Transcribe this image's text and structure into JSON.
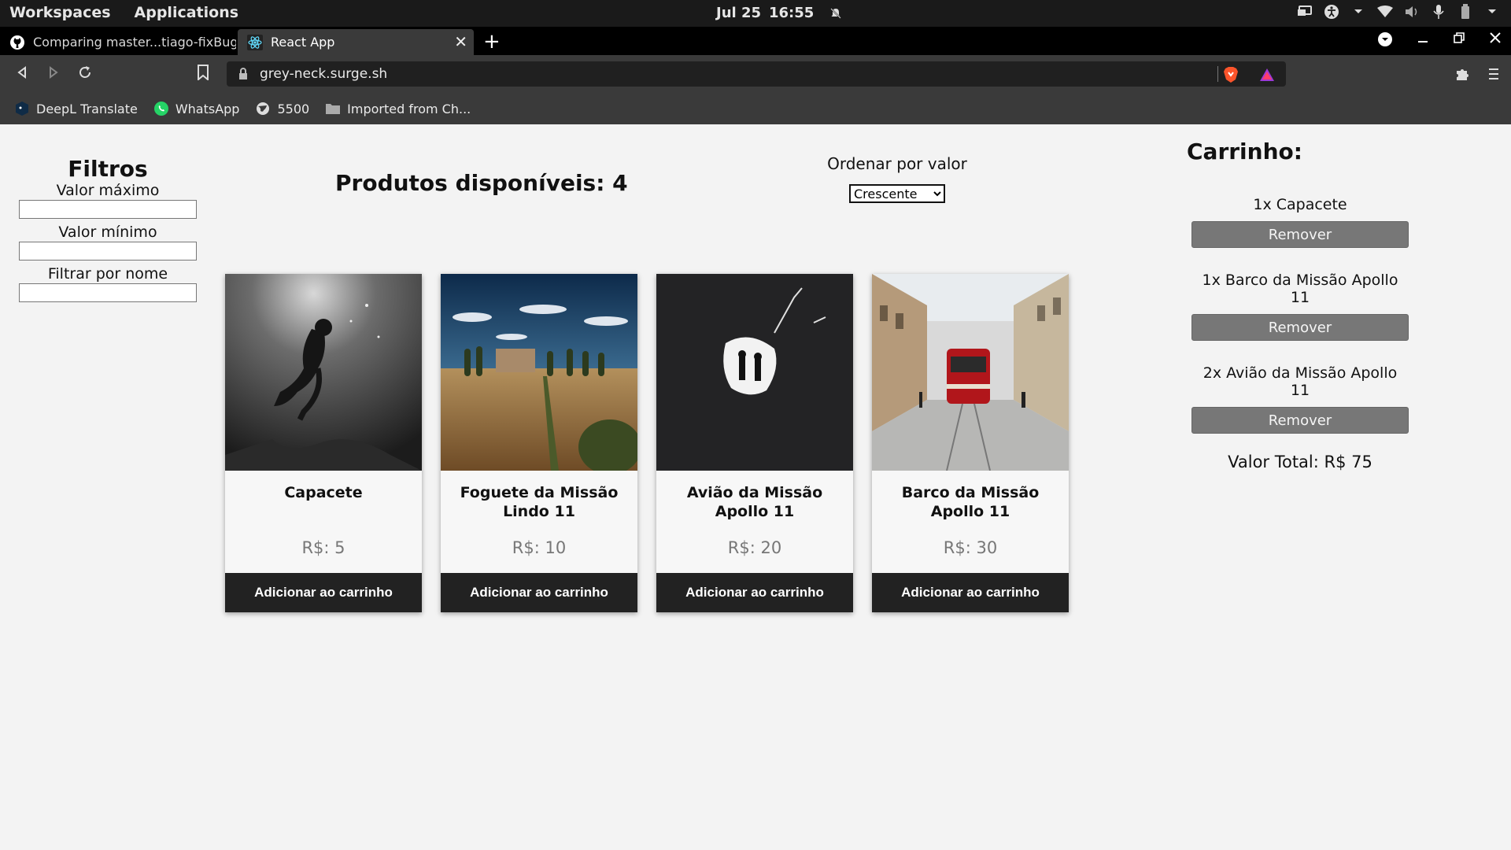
{
  "os": {
    "workspaces": "Workspaces",
    "applications": "Applications",
    "date": "Jul 25",
    "time": "16:55"
  },
  "browser": {
    "tabs": [
      {
        "title": "Comparing master...tiago-fixBug · f",
        "active": false
      },
      {
        "title": "React App",
        "active": true
      }
    ],
    "url": "grey-neck.surge.sh",
    "bookmarks": [
      {
        "label": "DeepL Translate",
        "icon": "deepl-icon"
      },
      {
        "label": "WhatsApp",
        "icon": "whatsapp-icon"
      },
      {
        "label": "5500",
        "icon": "globe-icon"
      },
      {
        "label": "Imported from Ch...",
        "icon": "folder-icon"
      }
    ]
  },
  "filters": {
    "title": "Filtros",
    "max_label": "Valor máximo",
    "min_label": "Valor mínimo",
    "name_label": "Filtrar por nome",
    "max_value": "",
    "min_value": "",
    "name_value": ""
  },
  "products": {
    "header": "Produtos disponíveis: 4",
    "sort_label": "Ordenar por valor",
    "sort_selected": "Crescente",
    "add_label": "Adicionar ao carrinho",
    "items": [
      {
        "name": "Capacete",
        "price": "R$: 5"
      },
      {
        "name": "Foguete da Missão Lindo 11",
        "price": "R$: 10"
      },
      {
        "name": "Avião da Missão Apollo 11",
        "price": "R$: 20"
      },
      {
        "name": "Barco da Missão Apollo 11",
        "price": "R$: 30"
      }
    ]
  },
  "cart": {
    "title": "Carrinho:",
    "remove_label": "Remover",
    "items": [
      {
        "text": "1x Capacete"
      },
      {
        "text": "1x Barco da Missão Apollo 11"
      },
      {
        "text": "2x Avião da Missão Apollo 11"
      }
    ],
    "total": "Valor Total: R$ 75"
  },
  "colors": {
    "page_bg": "#f3f3f3",
    "button_dark": "#222222",
    "button_gray": "#777777",
    "browser_chrome": "#3a3a3a"
  }
}
